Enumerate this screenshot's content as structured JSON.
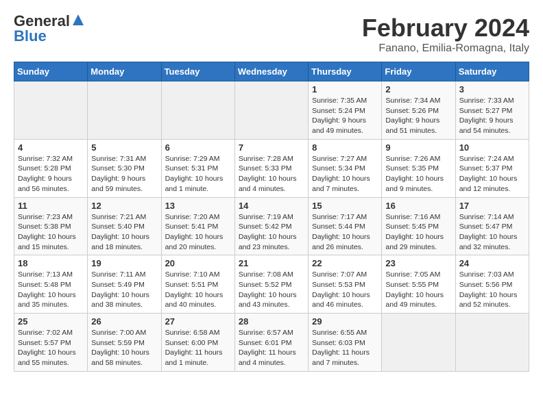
{
  "logo": {
    "line1_general": "General",
    "line2_blue": "Blue",
    "triangle_symbol": "▶"
  },
  "title": "February 2024",
  "subtitle": "Fanano, Emilia-Romagna, Italy",
  "days_of_week": [
    "Sunday",
    "Monday",
    "Tuesday",
    "Wednesday",
    "Thursday",
    "Friday",
    "Saturday"
  ],
  "weeks": [
    [
      {
        "day": "",
        "info": ""
      },
      {
        "day": "",
        "info": ""
      },
      {
        "day": "",
        "info": ""
      },
      {
        "day": "",
        "info": ""
      },
      {
        "day": "1",
        "info": "Sunrise: 7:35 AM\nSunset: 5:24 PM\nDaylight: 9 hours and 49 minutes."
      },
      {
        "day": "2",
        "info": "Sunrise: 7:34 AM\nSunset: 5:26 PM\nDaylight: 9 hours and 51 minutes."
      },
      {
        "day": "3",
        "info": "Sunrise: 7:33 AM\nSunset: 5:27 PM\nDaylight: 9 hours and 54 minutes."
      }
    ],
    [
      {
        "day": "4",
        "info": "Sunrise: 7:32 AM\nSunset: 5:28 PM\nDaylight: 9 hours and 56 minutes."
      },
      {
        "day": "5",
        "info": "Sunrise: 7:31 AM\nSunset: 5:30 PM\nDaylight: 9 hours and 59 minutes."
      },
      {
        "day": "6",
        "info": "Sunrise: 7:29 AM\nSunset: 5:31 PM\nDaylight: 10 hours and 1 minute."
      },
      {
        "day": "7",
        "info": "Sunrise: 7:28 AM\nSunset: 5:33 PM\nDaylight: 10 hours and 4 minutes."
      },
      {
        "day": "8",
        "info": "Sunrise: 7:27 AM\nSunset: 5:34 PM\nDaylight: 10 hours and 7 minutes."
      },
      {
        "day": "9",
        "info": "Sunrise: 7:26 AM\nSunset: 5:35 PM\nDaylight: 10 hours and 9 minutes."
      },
      {
        "day": "10",
        "info": "Sunrise: 7:24 AM\nSunset: 5:37 PM\nDaylight: 10 hours and 12 minutes."
      }
    ],
    [
      {
        "day": "11",
        "info": "Sunrise: 7:23 AM\nSunset: 5:38 PM\nDaylight: 10 hours and 15 minutes."
      },
      {
        "day": "12",
        "info": "Sunrise: 7:21 AM\nSunset: 5:40 PM\nDaylight: 10 hours and 18 minutes."
      },
      {
        "day": "13",
        "info": "Sunrise: 7:20 AM\nSunset: 5:41 PM\nDaylight: 10 hours and 20 minutes."
      },
      {
        "day": "14",
        "info": "Sunrise: 7:19 AM\nSunset: 5:42 PM\nDaylight: 10 hours and 23 minutes."
      },
      {
        "day": "15",
        "info": "Sunrise: 7:17 AM\nSunset: 5:44 PM\nDaylight: 10 hours and 26 minutes."
      },
      {
        "day": "16",
        "info": "Sunrise: 7:16 AM\nSunset: 5:45 PM\nDaylight: 10 hours and 29 minutes."
      },
      {
        "day": "17",
        "info": "Sunrise: 7:14 AM\nSunset: 5:47 PM\nDaylight: 10 hours and 32 minutes."
      }
    ],
    [
      {
        "day": "18",
        "info": "Sunrise: 7:13 AM\nSunset: 5:48 PM\nDaylight: 10 hours and 35 minutes."
      },
      {
        "day": "19",
        "info": "Sunrise: 7:11 AM\nSunset: 5:49 PM\nDaylight: 10 hours and 38 minutes."
      },
      {
        "day": "20",
        "info": "Sunrise: 7:10 AM\nSunset: 5:51 PM\nDaylight: 10 hours and 40 minutes."
      },
      {
        "day": "21",
        "info": "Sunrise: 7:08 AM\nSunset: 5:52 PM\nDaylight: 10 hours and 43 minutes."
      },
      {
        "day": "22",
        "info": "Sunrise: 7:07 AM\nSunset: 5:53 PM\nDaylight: 10 hours and 46 minutes."
      },
      {
        "day": "23",
        "info": "Sunrise: 7:05 AM\nSunset: 5:55 PM\nDaylight: 10 hours and 49 minutes."
      },
      {
        "day": "24",
        "info": "Sunrise: 7:03 AM\nSunset: 5:56 PM\nDaylight: 10 hours and 52 minutes."
      }
    ],
    [
      {
        "day": "25",
        "info": "Sunrise: 7:02 AM\nSunset: 5:57 PM\nDaylight: 10 hours and 55 minutes."
      },
      {
        "day": "26",
        "info": "Sunrise: 7:00 AM\nSunset: 5:59 PM\nDaylight: 10 hours and 58 minutes."
      },
      {
        "day": "27",
        "info": "Sunrise: 6:58 AM\nSunset: 6:00 PM\nDaylight: 11 hours and 1 minute."
      },
      {
        "day": "28",
        "info": "Sunrise: 6:57 AM\nSunset: 6:01 PM\nDaylight: 11 hours and 4 minutes."
      },
      {
        "day": "29",
        "info": "Sunrise: 6:55 AM\nSunset: 6:03 PM\nDaylight: 11 hours and 7 minutes."
      },
      {
        "day": "",
        "info": ""
      },
      {
        "day": "",
        "info": ""
      }
    ]
  ]
}
